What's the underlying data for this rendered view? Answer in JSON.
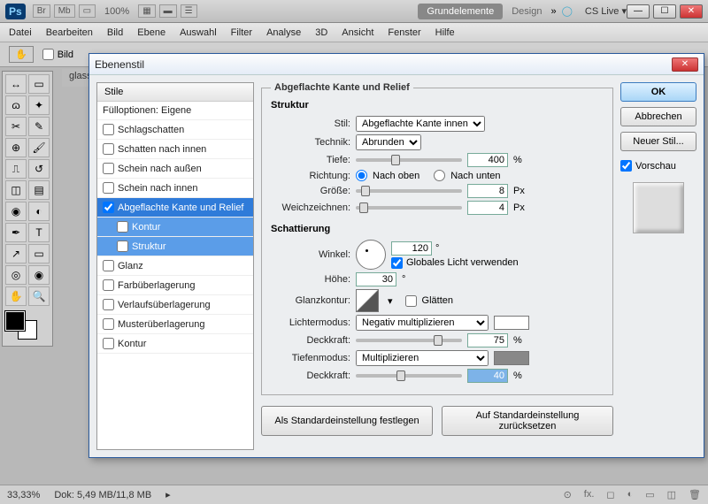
{
  "app": {
    "ps": "Ps",
    "zoom": "100%",
    "tabs": {
      "grundelemente": "Grundelemente",
      "design": "Design"
    },
    "arrows": "»",
    "cslive": "CS Live ▾"
  },
  "menu": {
    "datei": "Datei",
    "bearbeiten": "Bearbeiten",
    "bild": "Bild",
    "ebene": "Ebene",
    "auswahl": "Auswahl",
    "filter": "Filter",
    "analyse": "Analyse",
    "dreid": "3D",
    "ansicht": "Ansicht",
    "fenster": "Fenster",
    "hilfe": "Hilfe"
  },
  "optbar": {
    "bild": "Bild"
  },
  "doctab": "glassc",
  "dialog": {
    "title": "Ebenenstil",
    "styles_hdr": "Stile",
    "fulloptions": "Fülloptionen: Eigene",
    "items": {
      "schlagschatten": "Schlagschatten",
      "schatteninnen": "Schatten nach innen",
      "scheinaussen": "Schein nach außen",
      "scheininnen": "Schein nach innen",
      "bevel": "Abgeflachte Kante und Relief",
      "kontur": "Kontur",
      "struktur": "Struktur",
      "glanz": "Glanz",
      "farbuberl": "Farbüberlagerung",
      "verlaufuberl": "Verlaufsüberlagerung",
      "musteruberl": "Musterüberlagerung",
      "kontur2": "Kontur"
    },
    "panel_title": "Abgeflachte Kante und Relief",
    "struktur_hdr": "Struktur",
    "stil_lbl": "Stil:",
    "stil_val": "Abgeflachte Kante innen",
    "technik_lbl": "Technik:",
    "technik_val": "Abrunden",
    "tiefe_lbl": "Tiefe:",
    "tiefe_val": "400",
    "pct": "%",
    "richtung_lbl": "Richtung:",
    "nachoben": "Nach oben",
    "nachunten": "Nach unten",
    "groesse_lbl": "Größe:",
    "groesse_val": "8",
    "px": "Px",
    "weich_lbl": "Weichzeichnen:",
    "weich_val": "4",
    "schattierung_hdr": "Schattierung",
    "winkel_lbl": "Winkel:",
    "winkel_val": "120",
    "deg": "°",
    "globallicht": "Globales Licht verwenden",
    "hoehe_lbl": "Höhe:",
    "hoehe_val": "30",
    "glanzkontur_lbl": "Glanzkontur:",
    "glaetten": "Glätten",
    "lichtermodus_lbl": "Lichtermodus:",
    "lichtermodus_val": "Negativ multiplizieren",
    "deckkraft_lbl": "Deckkraft:",
    "deck1_val": "75",
    "tiefenmodus_lbl": "Tiefenmodus:",
    "tiefenmodus_val": "Multiplizieren",
    "deck2_val": "40",
    "btn_default": "Als Standardeinstellung festlegen",
    "btn_reset": "Auf Standardeinstellung zurücksetzen",
    "ok": "OK",
    "abbrechen": "Abbrechen",
    "neuerstil": "Neuer Stil...",
    "vorschau": "Vorschau"
  },
  "status": {
    "zoom": "33,33%",
    "dok": "Dok: 5,49 MB/11,8 MB"
  }
}
